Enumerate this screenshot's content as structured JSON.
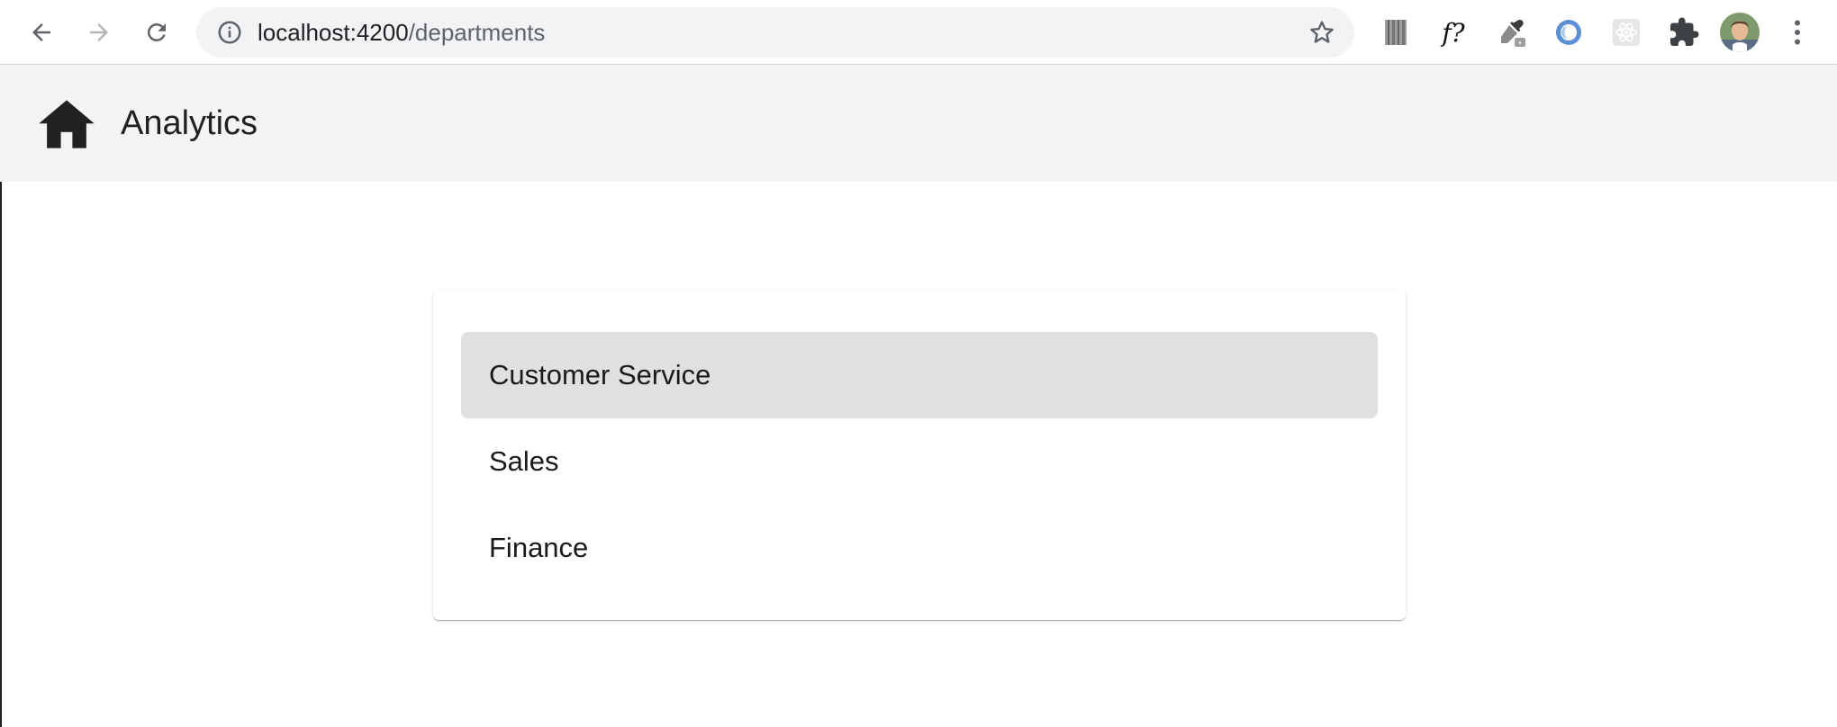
{
  "browser": {
    "url_host": "localhost:4200",
    "url_path": "/departments",
    "extensions": [
      "barcode-extension-icon",
      "font-finder-icon",
      "eyedropper-icon",
      "blue-ring-extension-icon",
      "react-devtools-icon",
      "puzzle-icon"
    ],
    "extension_fx_label": "f?"
  },
  "header": {
    "title": "Analytics"
  },
  "departments": {
    "items": [
      {
        "label": "Customer Service",
        "selected": true
      },
      {
        "label": "Sales",
        "selected": false
      },
      {
        "label": "Finance",
        "selected": false
      }
    ]
  },
  "colors": {
    "header_bg": "#f4f4f4",
    "selected_item_bg": "#e0e0e0",
    "omnibox_bg": "#f1f3f4"
  }
}
